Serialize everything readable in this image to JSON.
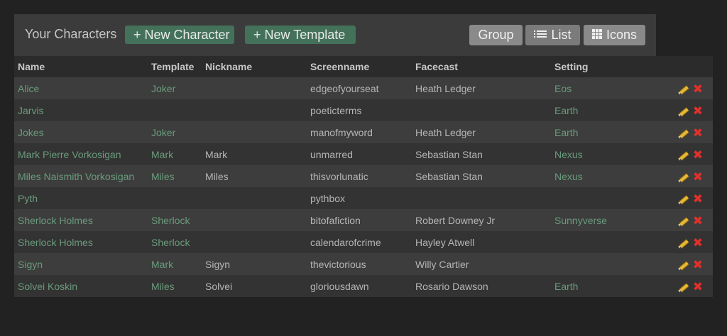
{
  "header": {
    "title": "Your Characters",
    "new_character_label": "+ New Character",
    "new_template_label": "+ New Template",
    "view_buttons": {
      "group": "Group",
      "list": "List",
      "icons": "Icons"
    }
  },
  "table": {
    "columns": [
      "Name",
      "Template",
      "Nickname",
      "Screenname",
      "Facecast",
      "Setting",
      ""
    ],
    "rows": [
      {
        "name": "Alice",
        "template": "Joker",
        "nickname": "",
        "screenname": "edgeofyourseat",
        "facecast": "Heath Ledger",
        "setting": "Eos"
      },
      {
        "name": "Jarvis",
        "template": "",
        "nickname": "",
        "screenname": "poeticterms",
        "facecast": "",
        "setting": "Earth"
      },
      {
        "name": "Jokes",
        "template": "Joker",
        "nickname": "",
        "screenname": "manofmyword",
        "facecast": "Heath Ledger",
        "setting": "Earth"
      },
      {
        "name": "Mark Pierre Vorkosigan",
        "template": "Mark",
        "nickname": "Mark",
        "screenname": "unmarred",
        "facecast": "Sebastian Stan",
        "setting": "Nexus"
      },
      {
        "name": "Miles Naismith Vorkosigan",
        "template": "Miles",
        "nickname": "Miles",
        "screenname": "thisvorlunatic",
        "facecast": "Sebastian Stan",
        "setting": "Nexus"
      },
      {
        "name": "Pyth",
        "template": "",
        "nickname": "",
        "screenname": "pythbox",
        "facecast": "",
        "setting": ""
      },
      {
        "name": "Sherlock Holmes",
        "template": "Sherlock",
        "nickname": "",
        "screenname": "bitofafiction",
        "facecast": "Robert Downey Jr",
        "setting": "Sunnyverse"
      },
      {
        "name": "Sherlock Holmes",
        "template": "Sherlock",
        "nickname": "",
        "screenname": "calendarofcrime",
        "facecast": "Hayley Atwell",
        "setting": ""
      },
      {
        "name": "Sigyn",
        "template": "Mark",
        "nickname": "Sigyn",
        "screenname": "thevictorious",
        "facecast": "Willy Cartier",
        "setting": ""
      },
      {
        "name": "Solvei Koskin",
        "template": "Miles",
        "nickname": "Solvei",
        "screenname": "gloriousdawn",
        "facecast": "Rosario Dawson",
        "setting": "Earth"
      }
    ]
  },
  "colors": {
    "background": "#222222",
    "panel": "#3b3b3b",
    "link_green": "#6a9a7c",
    "button_green": "#44715a",
    "button_grey": "#8a8a8a",
    "delete_red": "#e0302a",
    "edit_yellow": "#e8b835"
  },
  "icons": {
    "list": "list-icon",
    "grid": "grid-icon",
    "edit": "pencil-icon",
    "delete": "delete-x-icon"
  }
}
